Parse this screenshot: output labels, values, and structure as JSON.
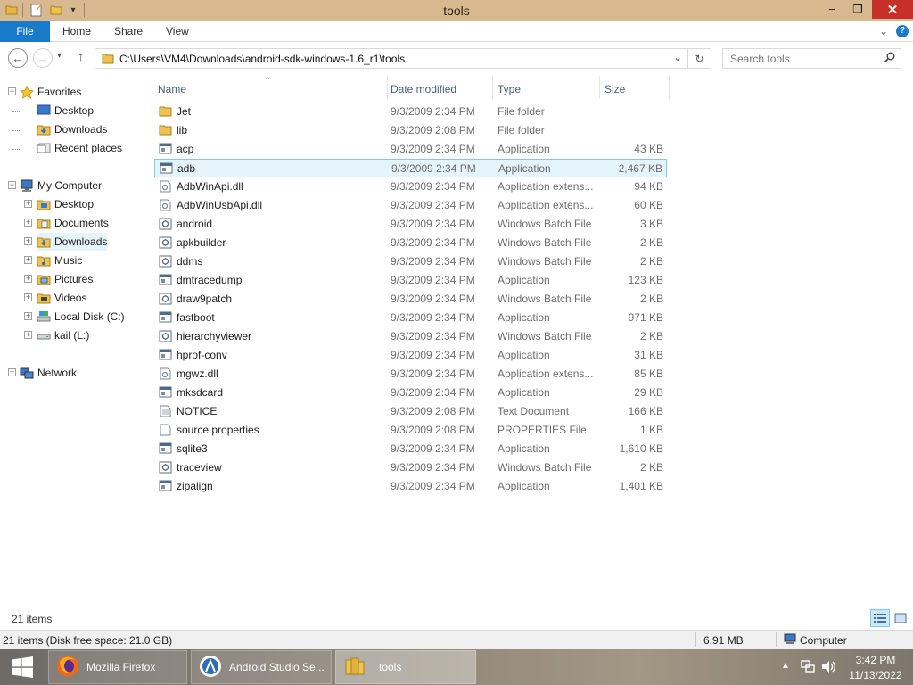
{
  "window": {
    "title": "tools",
    "min_glyph": "−",
    "restore_glyph": "❐",
    "close_glyph": "✕"
  },
  "ribbon": {
    "tabs": [
      "File",
      "Home",
      "Share",
      "View"
    ],
    "expand_glyph": "⌄",
    "help_glyph": "?"
  },
  "address": {
    "path": "C:\\Users\\VM4\\Downloads\\android-sdk-windows-1.6_r1\\tools",
    "back_glyph": "←",
    "forward_glyph": "→",
    "up_glyph": "↑",
    "dropdown_glyph": "⌄",
    "refresh_glyph": "↻"
  },
  "search": {
    "placeholder": "Search tools"
  },
  "navigation": {
    "favorites_label": "Favorites",
    "favorites": [
      "Desktop",
      "Downloads",
      "Recent places"
    ],
    "computer_label": "My Computer",
    "computer_items": [
      "Desktop",
      "Documents",
      "Downloads",
      "Music",
      "Pictures",
      "Videos",
      "Local Disk (C:)",
      "kail (L:)"
    ],
    "network_label": "Network"
  },
  "columns": {
    "name": "Name",
    "date": "Date modified",
    "type": "Type",
    "size": "Size"
  },
  "files": [
    {
      "name": "Jet",
      "date": "9/3/2009 2:34 PM",
      "type": "File folder",
      "size": "",
      "icon": "folder-icon"
    },
    {
      "name": "lib",
      "date": "9/3/2009 2:08 PM",
      "type": "File folder",
      "size": "",
      "icon": "folder-icon"
    },
    {
      "name": "acp",
      "date": "9/3/2009 2:34 PM",
      "type": "Application",
      "size": "43 KB",
      "icon": "application-icon"
    },
    {
      "name": "adb",
      "date": "9/3/2009 2:34 PM",
      "type": "Application",
      "size": "2,467 KB",
      "icon": "application-icon",
      "selected": true
    },
    {
      "name": "AdbWinApi.dll",
      "date": "9/3/2009 2:34 PM",
      "type": "Application extens...",
      "size": "94 KB",
      "icon": "dll-icon"
    },
    {
      "name": "AdbWinUsbApi.dll",
      "date": "9/3/2009 2:34 PM",
      "type": "Application extens...",
      "size": "60 KB",
      "icon": "dll-icon"
    },
    {
      "name": "android",
      "date": "9/3/2009 2:34 PM",
      "type": "Windows Batch File",
      "size": "3 KB",
      "icon": "batch-file-icon"
    },
    {
      "name": "apkbuilder",
      "date": "9/3/2009 2:34 PM",
      "type": "Windows Batch File",
      "size": "2 KB",
      "icon": "batch-file-icon"
    },
    {
      "name": "ddms",
      "date": "9/3/2009 2:34 PM",
      "type": "Windows Batch File",
      "size": "2 KB",
      "icon": "batch-file-icon"
    },
    {
      "name": "dmtracedump",
      "date": "9/3/2009 2:34 PM",
      "type": "Application",
      "size": "123 KB",
      "icon": "application-icon"
    },
    {
      "name": "draw9patch",
      "date": "9/3/2009 2:34 PM",
      "type": "Windows Batch File",
      "size": "2 KB",
      "icon": "batch-file-icon"
    },
    {
      "name": "fastboot",
      "date": "9/3/2009 2:34 PM",
      "type": "Application",
      "size": "971 KB",
      "icon": "application-icon"
    },
    {
      "name": "hierarchyviewer",
      "date": "9/3/2009 2:34 PM",
      "type": "Windows Batch File",
      "size": "2 KB",
      "icon": "batch-file-icon"
    },
    {
      "name": "hprof-conv",
      "date": "9/3/2009 2:34 PM",
      "type": "Application",
      "size": "31 KB",
      "icon": "application-icon"
    },
    {
      "name": "mgwz.dll",
      "date": "9/3/2009 2:34 PM",
      "type": "Application extens...",
      "size": "85 KB",
      "icon": "dll-icon"
    },
    {
      "name": "mksdcard",
      "date": "9/3/2009 2:34 PM",
      "type": "Application",
      "size": "29 KB",
      "icon": "application-icon"
    },
    {
      "name": "NOTICE",
      "date": "9/3/2009 2:08 PM",
      "type": "Text Document",
      "size": "166 KB",
      "icon": "text-document-icon"
    },
    {
      "name": "source.properties",
      "date": "9/3/2009 2:08 PM",
      "type": "PROPERTIES File",
      "size": "1 KB",
      "icon": "generic-file-icon"
    },
    {
      "name": "sqlite3",
      "date": "9/3/2009 2:34 PM",
      "type": "Application",
      "size": "1,610 KB",
      "icon": "application-icon"
    },
    {
      "name": "traceview",
      "date": "9/3/2009 2:34 PM",
      "type": "Windows Batch File",
      "size": "2 KB",
      "icon": "batch-file-icon"
    },
    {
      "name": "zipalign",
      "date": "9/3/2009 2:34 PM",
      "type": "Application",
      "size": "1,401 KB",
      "icon": "application-icon"
    }
  ],
  "status": {
    "item_count": "21 items",
    "detail": "21 items (Disk free space: 21.0 GB)",
    "size": "6.91 MB",
    "location": "Computer"
  },
  "taskbar": {
    "buttons": [
      "Mozilla Firefox",
      "Android Studio Se...",
      "tools"
    ],
    "time": "3:42 PM",
    "date": "11/13/2022"
  },
  "colors": {
    "titlebar": "#d7b88f",
    "file_tab": "#1979ca",
    "selection_bg": "#e5f3fb",
    "selection_border": "#7ecbe8",
    "close_button": "#c7302a"
  }
}
